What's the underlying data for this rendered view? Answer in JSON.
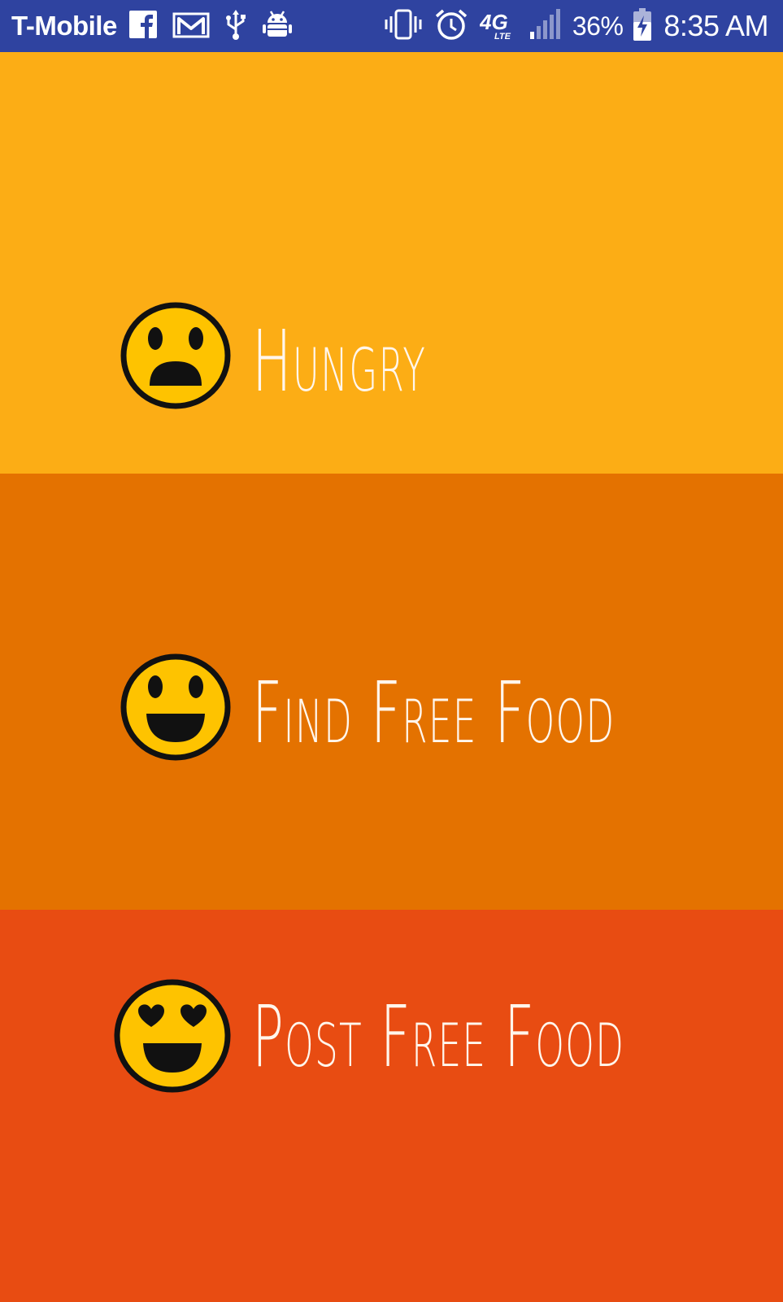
{
  "status_bar": {
    "carrier": "T-Mobile",
    "left_icons": [
      "facebook-icon",
      "gmail-icon",
      "usb-icon",
      "android-debug-icon"
    ],
    "right_icons": [
      "vibrate-icon",
      "alarm-icon",
      "4g-lte-icon",
      "signal-icon",
      "battery-charging-icon"
    ],
    "battery_percent": "36%",
    "time": "8:35 AM",
    "color": "#2f43a0"
  },
  "panels": [
    {
      "label": "Hungry",
      "emoji": "frowning-face-icon",
      "color": "#fcad15"
    },
    {
      "label": "Find Free Food",
      "emoji": "smiling-face-icon",
      "color": "#e47200"
    },
    {
      "label": "Post Free Food",
      "emoji": "heart-eyes-face-icon",
      "color": "#e84c12"
    }
  ],
  "emoji_color": "#fec300"
}
